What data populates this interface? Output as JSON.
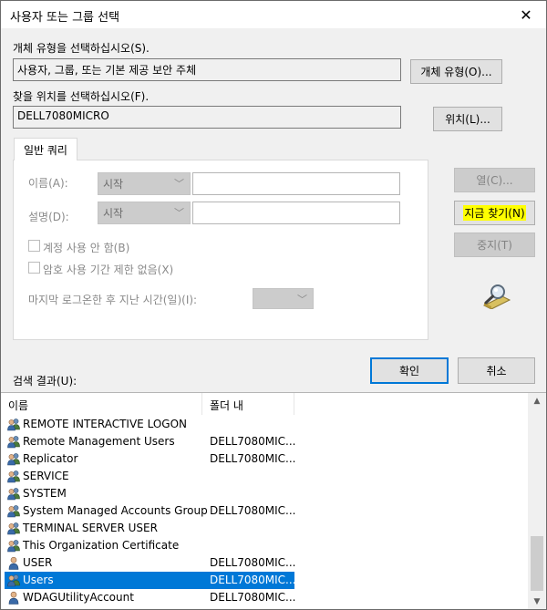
{
  "dialog": {
    "title": "사용자 또는 그룹 선택",
    "close_glyph": "✕"
  },
  "object_type": {
    "label": "개체 유형을 선택하십시오(S).",
    "value": "사용자, 그룹, 또는 기본 제공 보안 주체",
    "button": "개체 유형(O)..."
  },
  "location": {
    "label": "찾을 위치를 선택하십시오(F).",
    "value": "DELL7080MICRO",
    "button": "위치(L)..."
  },
  "query": {
    "tab_label": "일반 쿼리",
    "name_label": "이름(A):",
    "name_mode": "시작",
    "desc_label": "설명(D):",
    "desc_mode": "시작",
    "disabled_accounts_label": "계정 사용 안 함(B)",
    "no_expire_label": "암호 사용 기간 제한 없음(X)",
    "last_logon_label": "마지막 로그온한 후 지난 시간(일)(I):"
  },
  "side_buttons": {
    "columns": "열(C)...",
    "find_now": "지금 찾기(N)",
    "stop": "중지(T)"
  },
  "actions": {
    "ok": "확인",
    "cancel": "취소"
  },
  "results": {
    "label": "검색 결과(U):",
    "columns": [
      "이름",
      "폴더 내"
    ],
    "rows": [
      {
        "name": "REMOTE INTERACTIVE LOGON",
        "folder": "",
        "icon": "group-icon"
      },
      {
        "name": "Remote Management Users",
        "folder": "DELL7080MIC...",
        "icon": "group-icon"
      },
      {
        "name": "Replicator",
        "folder": "DELL7080MIC...",
        "icon": "group-icon"
      },
      {
        "name": "SERVICE",
        "folder": "",
        "icon": "group-icon"
      },
      {
        "name": "SYSTEM",
        "folder": "",
        "icon": "group-icon"
      },
      {
        "name": "System Managed Accounts Group",
        "folder": "DELL7080MIC...",
        "icon": "group-icon"
      },
      {
        "name": "TERMINAL SERVER USER",
        "folder": "",
        "icon": "group-icon"
      },
      {
        "name": "This Organization Certificate",
        "folder": "",
        "icon": "group-icon"
      },
      {
        "name": "USER",
        "folder": "DELL7080MIC...",
        "icon": "user-icon"
      },
      {
        "name": "Users",
        "folder": "DELL7080MIC...",
        "icon": "group-icon",
        "selected": true
      },
      {
        "name": "WDAGUtilityAccount",
        "folder": "DELL7080MIC...",
        "icon": "user-icon"
      }
    ]
  },
  "colors": {
    "accent": "#0078d7",
    "highlight": "#ffff00"
  }
}
